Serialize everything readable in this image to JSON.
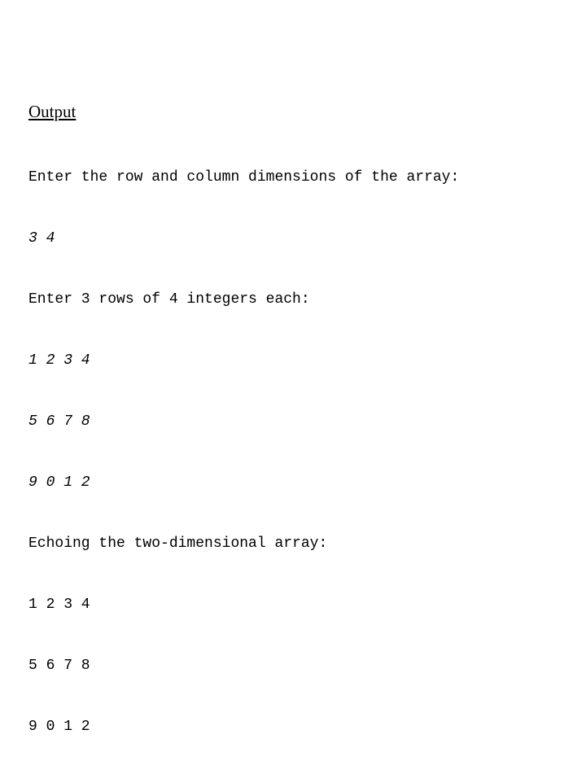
{
  "heading": "Output",
  "lines": [
    {
      "text": "Enter the row and column dimensions of the array:",
      "input": false
    },
    {
      "text": "3 4",
      "input": true
    },
    {
      "text": "Enter 3 rows of 4 integers each:",
      "input": false
    },
    {
      "text": "1 2 3 4",
      "input": true
    },
    {
      "text": "5 6 7 8",
      "input": true
    },
    {
      "text": "9 0 1 2",
      "input": true
    },
    {
      "text": "Echoing the two-dimensional array:",
      "input": false
    },
    {
      "text": "1 2 3 4",
      "input": false
    },
    {
      "text": "5 6 7 8",
      "input": false
    },
    {
      "text": "9 0 1 2",
      "input": false
    }
  ]
}
